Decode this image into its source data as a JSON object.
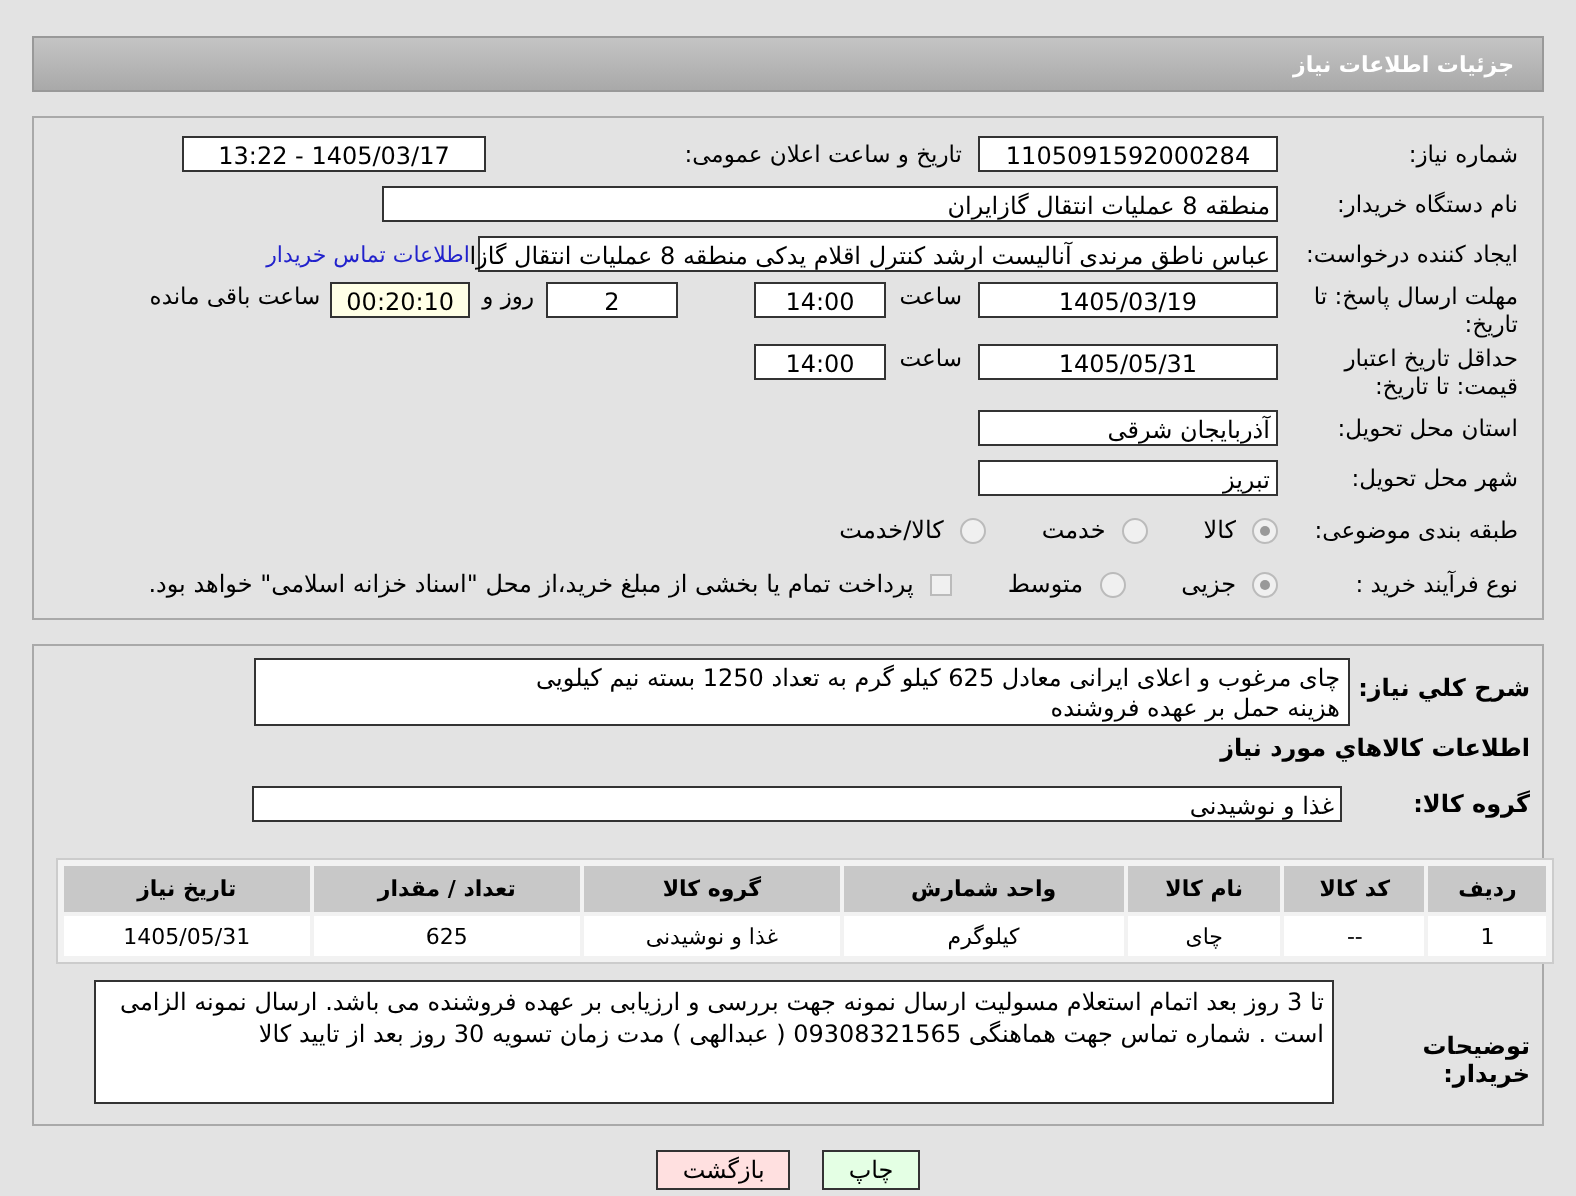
{
  "header": {
    "title": "جزئیات اطلاعات نیاز"
  },
  "info": {
    "need_number": {
      "label": "شماره نیاز:",
      "value": "1105091592000284"
    },
    "announce": {
      "label": "تاریخ و ساعت اعلان عمومی:",
      "value": "1405/03/17 - 13:22"
    },
    "buyer_org": {
      "label": "نام دستگاه خریدار:",
      "value": "منطقه 8 عملیات انتقال گازایران"
    },
    "creator": {
      "label": "ایجاد کننده درخواست:",
      "value": "عباس ناطق مرندی آنالیست ارشد کنترل اقلام یدکی منطقه 8 عملیات انتقال گازا",
      "link": "اطلاعات تماس خریدار"
    },
    "reply_deadline": {
      "label": "مهلت ارسال پاسخ: تا تاریخ:",
      "date": "1405/03/19",
      "time_label": "ساعت",
      "time": "14:00",
      "days": "2",
      "days_label": "روز و",
      "remaining": "00:20:10",
      "remaining_label": "ساعت باقی مانده"
    },
    "price_validity": {
      "label": "حداقل تاریخ اعتبار قیمت: تا تاریخ:",
      "date": "1405/05/31",
      "time_label": "ساعت",
      "time": "14:00"
    },
    "province": {
      "label": "استان محل تحویل:",
      "value": "آذربایجان شرقی"
    },
    "city": {
      "label": "شهر محل تحویل:",
      "value": "تبریز"
    },
    "category": {
      "label": "طبقه بندی موضوعی:",
      "options": [
        {
          "label": "کالا",
          "selected": true
        },
        {
          "label": "خدمت",
          "selected": false
        },
        {
          "label": "کالا/خدمت",
          "selected": false
        }
      ]
    },
    "process": {
      "label": "نوع فرآیند خرید :",
      "options": [
        {
          "label": "جزیی",
          "selected": true
        },
        {
          "label": "متوسط",
          "selected": false
        }
      ],
      "payment_note": {
        "checked": false,
        "text": "پرداخت تمام یا بخشی از مبلغ خرید،از محل \"اسناد خزانه اسلامی\" خواهد بود."
      }
    }
  },
  "details": {
    "description": {
      "label": "شرح كلي نياز:",
      "lines": [
        "چای مرغوب و اعلای ایرانی معادل 625 کیلو گرم به تعداد 1250 بسته نیم کیلویی",
        "هزینه حمل بر عهده فروشنده"
      ]
    },
    "goods_title": "اطلاعات كالاهاي مورد نياز",
    "goods_group": {
      "label": "گروه کالا:",
      "value": "غذا و نوشیدنی"
    },
    "table": {
      "columns": [
        "ردیف",
        "کد کالا",
        "نام کالا",
        "واحد شمارش",
        "گروه کالا",
        "تعداد / مقدار",
        "تاریخ نیاز"
      ],
      "rows": [
        [
          "1",
          "--",
          "چای",
          "کیلوگرم",
          "غذا و نوشیدنی",
          "625",
          "1405/05/31"
        ]
      ]
    },
    "buyer_notes": {
      "label": "توضیحات خریدار:",
      "text": "تا 3 روز بعد اتمام استعلام مسولیت ارسال نمونه جهت بررسی و ارزیابی بر عهده فروشنده می باشد. ارسال نمونه الزامی است . شماره تماس جهت هماهنگی 09308321565 ( عبدالهی ) مدت زمان تسویه 30 روز بعد از تایید کالا"
    }
  },
  "buttons": [
    {
      "label": "چاپ",
      "kind": "print"
    },
    {
      "label": "بازگشت",
      "kind": "back"
    }
  ]
}
